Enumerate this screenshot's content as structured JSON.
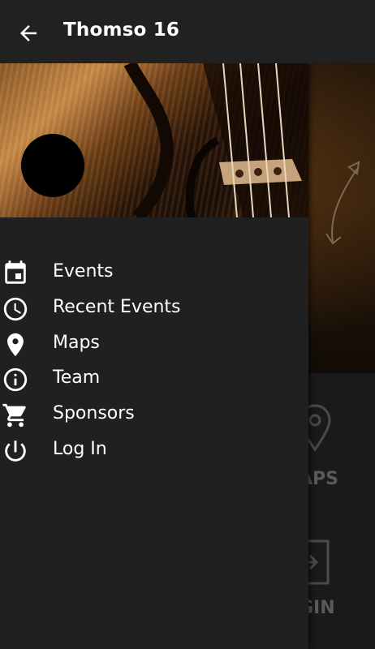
{
  "appbar": {
    "title": "Thomso 16",
    "back_icon": "arrow-back-icon"
  },
  "background": {
    "tiles": [
      {
        "label": "APS",
        "icon": "location-pin-icon"
      },
      {
        "label": "GIN",
        "icon": "login-icon"
      }
    ]
  },
  "drawer": {
    "header_image": "violin-image",
    "menu": [
      {
        "label": "Events",
        "icon": "calendar-icon"
      },
      {
        "label": "Recent Events",
        "icon": "clock-icon"
      },
      {
        "label": "Maps",
        "icon": "location-pin-icon"
      },
      {
        "label": "Team",
        "icon": "info-icon"
      },
      {
        "label": "Sponsors",
        "icon": "cart-icon"
      },
      {
        "label": "Log In",
        "icon": "power-icon"
      }
    ]
  },
  "colors": {
    "appbar": "#212121",
    "drawer": "#202020",
    "text": "#ffffff"
  }
}
